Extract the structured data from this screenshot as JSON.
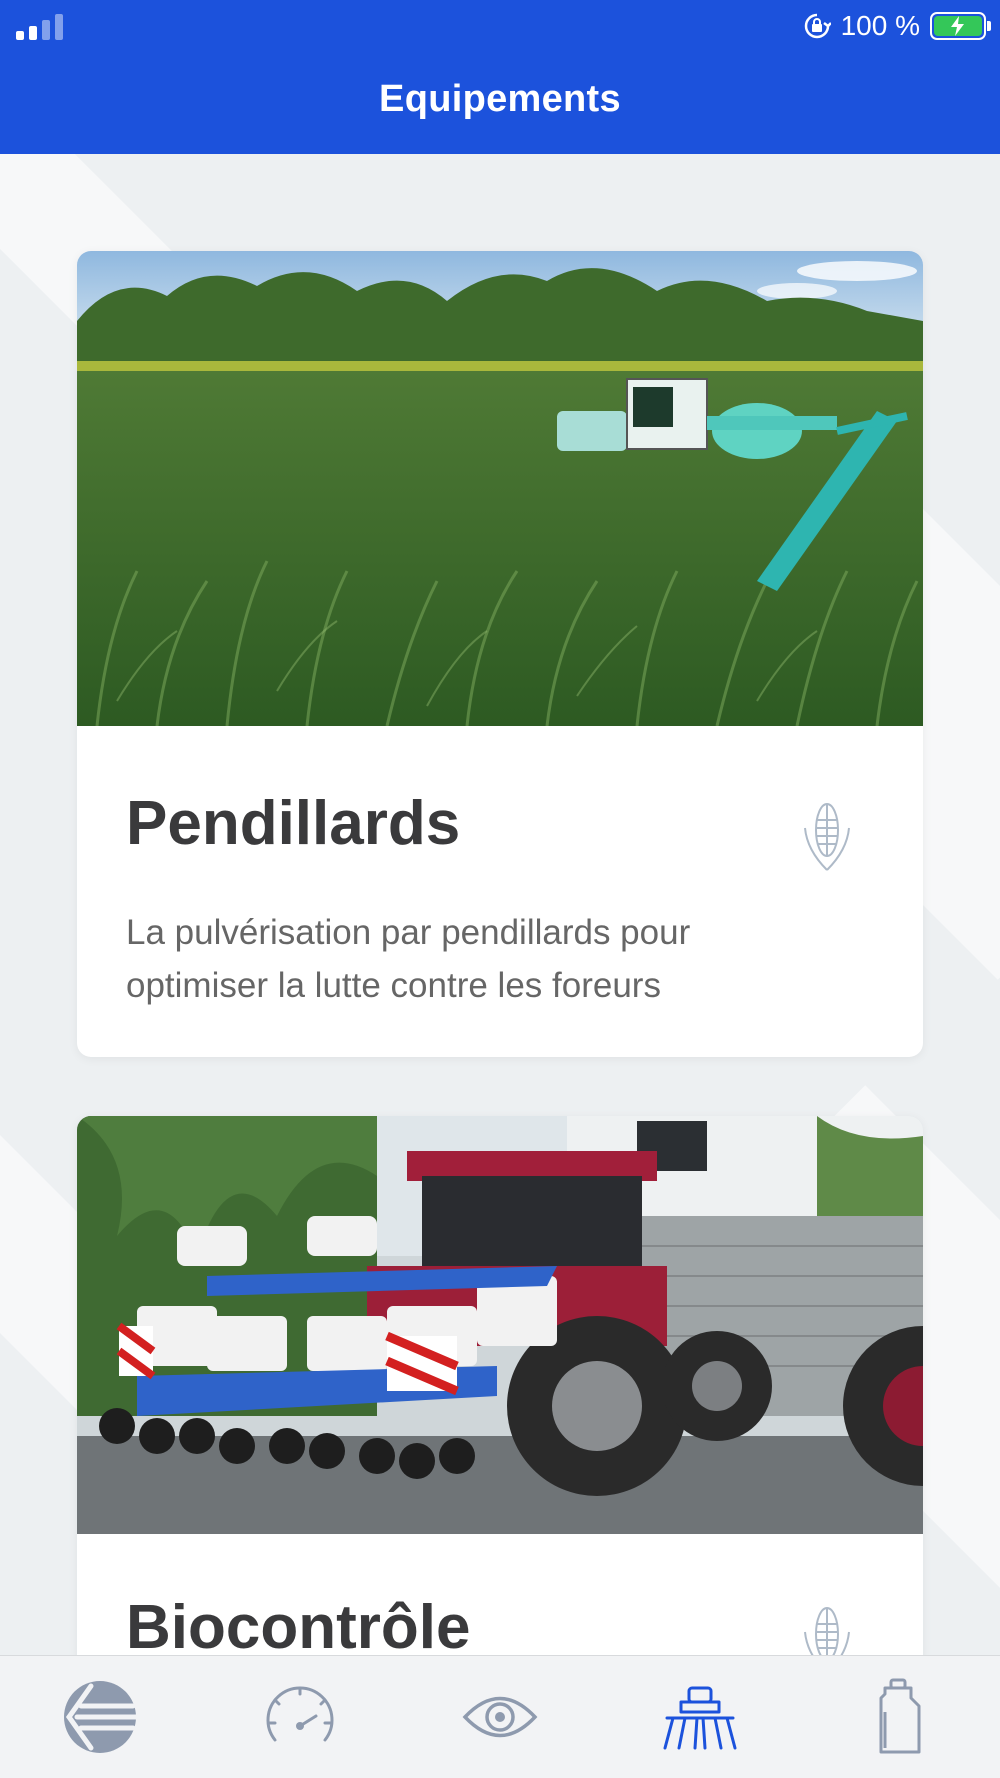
{
  "status_bar": {
    "battery": "100 %",
    "icons": [
      "signal-icon",
      "orientation-lock-icon",
      "battery-charging-icon"
    ]
  },
  "header": {
    "title": "Equipements"
  },
  "cards": [
    {
      "title": "Pendillards",
      "description": "La pulvérisation par pendillards pour optimiser la lutte contre les foreurs",
      "icon": "corn-icon",
      "image": "sprayer-in-cornfield"
    },
    {
      "title": "Biocontrôle",
      "icon": "corn-icon",
      "image": "tractor-with-planter"
    }
  ],
  "tabbar": {
    "items": [
      {
        "icon": "brand-logo-icon"
      },
      {
        "icon": "speedometer-icon"
      },
      {
        "icon": "eye-icon"
      },
      {
        "icon": "sprayer-icon",
        "active": true
      },
      {
        "icon": "canister-icon"
      }
    ]
  },
  "colors": {
    "header": "#1c52dc",
    "tab_inactive": "#8e9aae",
    "tab_active": "#1c52dc",
    "battery": "#34c759"
  }
}
